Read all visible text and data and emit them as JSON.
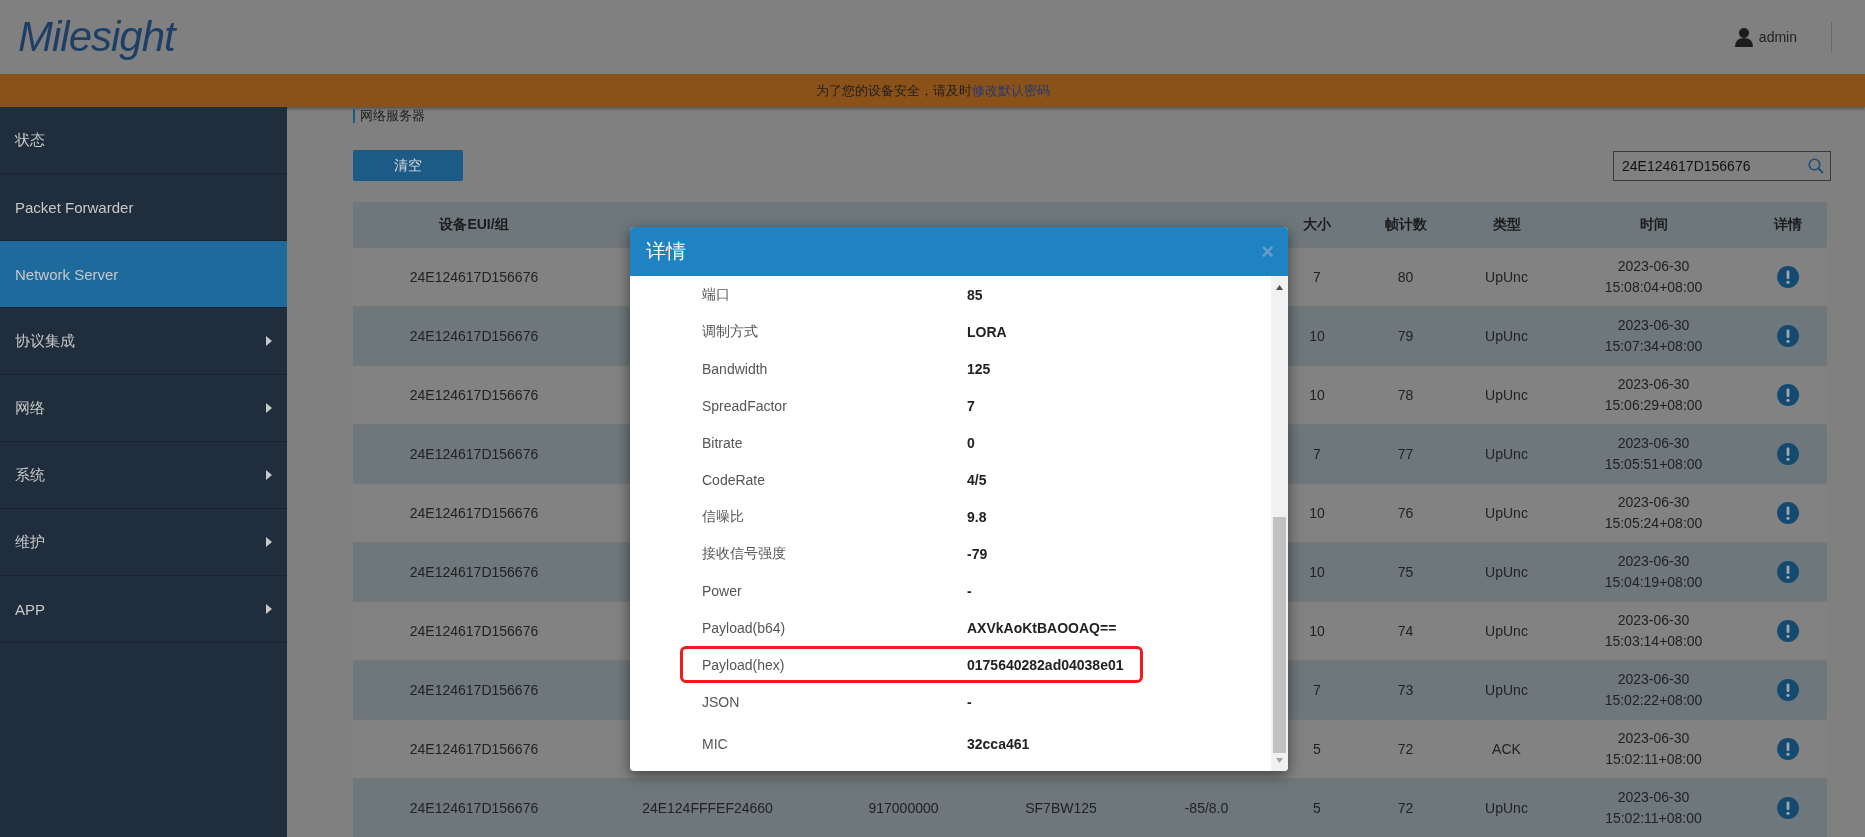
{
  "header": {
    "logo": "Milesight",
    "user": "admin"
  },
  "banner": {
    "text": "为了您的设备安全，请及时",
    "link": "修改默认密码"
  },
  "sidebar": {
    "items": [
      {
        "label": "状态",
        "selected": false,
        "has_submenu": false
      },
      {
        "label": "Packet Forwarder",
        "selected": false,
        "has_submenu": false
      },
      {
        "label": "Network Server",
        "selected": true,
        "has_submenu": false
      },
      {
        "label": "协议集成",
        "selected": false,
        "has_submenu": true
      },
      {
        "label": "网络",
        "selected": false,
        "has_submenu": true
      },
      {
        "label": "系统",
        "selected": false,
        "has_submenu": true
      },
      {
        "label": "维护",
        "selected": false,
        "has_submenu": true
      },
      {
        "label": "APP",
        "selected": false,
        "has_submenu": true
      }
    ]
  },
  "breadcrumb": "网络服务器",
  "toolbar": {
    "clear_button": "清空",
    "search": {
      "value": "24E124617D156676"
    }
  },
  "table": {
    "columns": [
      "设备EUI/组",
      "大小",
      "帧计数",
      "类型",
      "时间",
      "详情"
    ],
    "rows": [
      {
        "eui": "24E124617D156676",
        "size": "7",
        "fcnt": "80",
        "type": "UpUnc",
        "time": "2023-06-30\n15:08:04+08:00"
      },
      {
        "eui": "24E124617D156676",
        "size": "10",
        "fcnt": "79",
        "type": "UpUnc",
        "time": "2023-06-30\n15:07:34+08:00"
      },
      {
        "eui": "24E124617D156676",
        "size": "10",
        "fcnt": "78",
        "type": "UpUnc",
        "time": "2023-06-30\n15:06:29+08:00"
      },
      {
        "eui": "24E124617D156676",
        "size": "7",
        "fcnt": "77",
        "type": "UpUnc",
        "time": "2023-06-30\n15:05:51+08:00"
      },
      {
        "eui": "24E124617D156676",
        "size": "10",
        "fcnt": "76",
        "type": "UpUnc",
        "time": "2023-06-30\n15:05:24+08:00"
      },
      {
        "eui": "24E124617D156676",
        "size": "10",
        "fcnt": "75",
        "type": "UpUnc",
        "time": "2023-06-30\n15:04:19+08:00"
      },
      {
        "eui": "24E124617D156676",
        "size": "10",
        "fcnt": "74",
        "type": "UpUnc",
        "time": "2023-06-30\n15:03:14+08:00"
      },
      {
        "eui": "24E124617D156676",
        "size": "7",
        "fcnt": "73",
        "type": "UpUnc",
        "time": "2023-06-30\n15:02:22+08:00"
      },
      {
        "eui": "24E124617D156676",
        "size": "5",
        "fcnt": "72",
        "type": "ACK",
        "time": "2023-06-30\n15:02:11+08:00"
      },
      {
        "eui": "24E124617D156676",
        "gateway": "24E124FFFEF24660",
        "frequency": "917000000",
        "rate": "SF7BW125",
        "rssi_snr": "-85/8.0",
        "size": "5",
        "fcnt": "72",
        "type": "UpUnc",
        "time": "2023-06-30\n15:02:11+08:00"
      }
    ]
  },
  "dialog": {
    "title": "详情",
    "close": "×",
    "rows": [
      {
        "label": "端口",
        "value": "85",
        "highlighted": false
      },
      {
        "label": "调制方式",
        "value": "LORA",
        "highlighted": false
      },
      {
        "label": "Bandwidth",
        "value": "125",
        "highlighted": false
      },
      {
        "label": "SpreadFactor",
        "value": "7",
        "highlighted": false
      },
      {
        "label": "Bitrate",
        "value": "0",
        "highlighted": false
      },
      {
        "label": "CodeRate",
        "value": "4/5",
        "highlighted": false
      },
      {
        "label": "信噪比",
        "value": "9.8",
        "highlighted": false
      },
      {
        "label": "接收信号强度",
        "value": "-79",
        "highlighted": false
      },
      {
        "label": "Power",
        "value": "-",
        "highlighted": false
      },
      {
        "label": "Payload(b64)",
        "value": "AXVkAoKtBAOOAQ==",
        "highlighted": false
      },
      {
        "label": "Payload(hex)",
        "value": "0175640282ad04038e01",
        "highlighted": true
      },
      {
        "label": "JSON",
        "value": "-",
        "highlighted": false
      },
      {
        "label": "MIC",
        "value": "32cca461",
        "highlighted": false
      }
    ]
  }
}
